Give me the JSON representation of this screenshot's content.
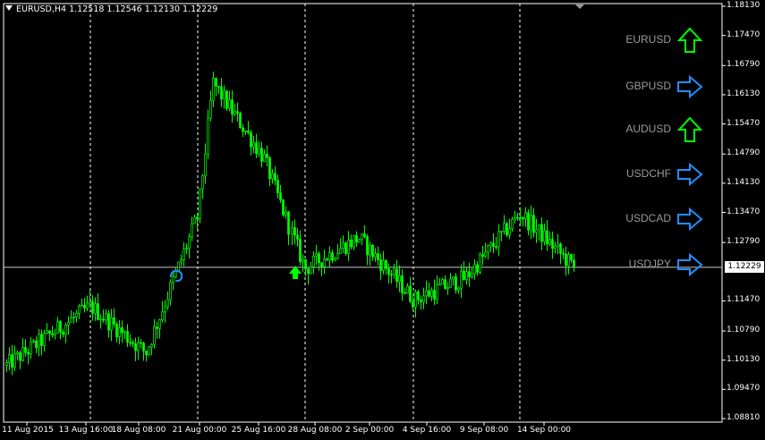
{
  "chart": {
    "title_symbol": "EURUSD,H4",
    "title_values": "1.12518 1.12546 1.12130 1.12229",
    "current_price": "1.12229",
    "colors": {
      "background": "#000000",
      "candles": "#00ff00",
      "grid": "#ffffff",
      "axis": "#ffffff",
      "up_arrow": "#00ff00",
      "side_arrow": "#1e90ff",
      "symbol_text": "#9a9a9a"
    },
    "price_labels": [
      "1.18130",
      "1.17470",
      "1.16790",
      "1.16130",
      "1.15470",
      "1.14790",
      "1.14130",
      "1.13470",
      "1.12790",
      "1.12229",
      "1.11470",
      "1.10790",
      "1.10130",
      "1.09470",
      "1.08810"
    ],
    "time_labels": [
      "11 Aug 2015",
      "13 Aug 16:00",
      "18 Aug 08:00",
      "21 Aug 00:00",
      "25 Aug 16:00",
      "28 Aug 08:00",
      "2 Sep 00:00",
      "4 Sep 16:00",
      "9 Sep 08:00",
      "14 Sep 00:00"
    ]
  },
  "chart_data": {
    "type": "candlestick",
    "symbol": "EURUSD",
    "timeframe": "H4",
    "ylim": [
      1.0881,
      1.1813
    ],
    "last_bar": {
      "open": 1.12518,
      "high": 1.12546,
      "low": 1.1213,
      "close": 1.12229
    },
    "close_path": [
      {
        "x": "11 Aug 2015",
        "y": 1.1
      },
      {
        "x": "13 Aug 16:00",
        "y": 1.1135
      },
      {
        "x": "18 Aug 08:00",
        "y": 1.103
      },
      {
        "x": "21 Aug 00:00",
        "y": 1.134
      },
      {
        "x": "21 Aug 12:00",
        "y": 1.164
      },
      {
        "x": "25 Aug 16:00",
        "y": 1.147
      },
      {
        "x": "28 Aug 08:00",
        "y": 1.122
      },
      {
        "x": "2 Sep 00:00",
        "y": 1.129
      },
      {
        "x": "4 Sep 16:00",
        "y": 1.115
      },
      {
        "x": "9 Sep 08:00",
        "y": 1.12
      },
      {
        "x": "14 Sep 00:00",
        "y": 1.1345
      },
      {
        "x": "16 Sep",
        "y": 1.1223
      }
    ]
  },
  "signals": [
    {
      "symbol": "EURUSD",
      "direction": "up",
      "icon": "up-arrow-icon"
    },
    {
      "symbol": "GBPUSD",
      "direction": "right",
      "icon": "right-arrow-icon"
    },
    {
      "symbol": "AUDUSD",
      "direction": "up",
      "icon": "up-arrow-icon"
    },
    {
      "symbol": "USDCHF",
      "direction": "right",
      "icon": "right-arrow-icon"
    },
    {
      "symbol": "USDCAD",
      "direction": "right",
      "icon": "right-arrow-icon"
    },
    {
      "symbol": "USDJPY",
      "direction": "right",
      "icon": "right-arrow-icon"
    }
  ]
}
